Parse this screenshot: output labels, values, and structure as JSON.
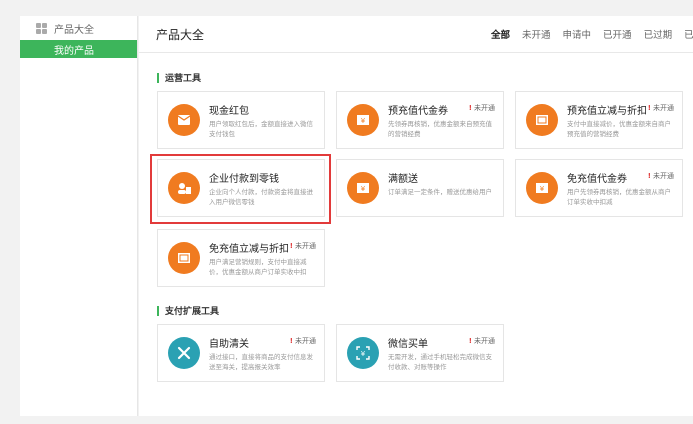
{
  "sidebar": {
    "header_label": "产品大全",
    "active_item": "我的产品"
  },
  "main": {
    "title": "产品大全",
    "filters": [
      "全部",
      "未开通",
      "申请中",
      "已开通",
      "已过期",
      "已关闭"
    ],
    "active_filter": "全部",
    "sections": [
      {
        "title": "运营工具"
      },
      {
        "title": "支付扩展工具"
      }
    ],
    "cards": [
      {
        "name": "现金红包",
        "desc": "用户领取红包后，金额直接进入微信支付钱包",
        "badge": "",
        "icon": "red-envelope-icon",
        "color": "#f07b20"
      },
      {
        "name": "预充值代金券",
        "desc": "先领券再核销，优惠金额来自预充值的营销经费",
        "badge": "未开通",
        "icon": "voucher-icon",
        "color": "#f07b20"
      },
      {
        "name": "预充值立减与折扣",
        "desc": "支付中直接减价，优惠金额来自商户预充值的营销经费",
        "badge": "未开通",
        "icon": "discount-icon",
        "color": "#f07b20"
      },
      {
        "name": "企业付款到零钱",
        "desc": "企业向个人付款，付款资金将直接进入用户微信零钱",
        "badge": "",
        "icon": "enterprise-pay-icon",
        "color": "#f07b20"
      },
      {
        "name": "满额送",
        "desc": "订单满足一定条件，赠送优惠给用户",
        "badge": "",
        "icon": "gift-icon",
        "color": "#f07b20"
      },
      {
        "name": "免充值代金券",
        "desc": "用户先领券再核销，优惠金额从商户订单实收中扣减",
        "badge": "未开通",
        "icon": "voucher-icon",
        "color": "#f07b20"
      },
      {
        "name": "免充值立减与折扣",
        "desc": "用户满足营销规则，支付中直接减价，优惠金额从商户订单实收中扣",
        "badge": "未开通",
        "icon": "discount-icon",
        "color": "#f07b20"
      },
      {
        "name": "自助清关",
        "desc": "通过接口，直接将商品的支付信息发送至海关，提高报关效率",
        "badge": "未开通",
        "icon": "tools-icon",
        "color": "#2aa1b3"
      },
      {
        "name": "微信买单",
        "desc": "无需开发，通过手机轻松完成微信支付收款、对账等操作",
        "badge": "未开通",
        "icon": "scan-pay-icon",
        "color": "#2aa1b3"
      }
    ]
  }
}
